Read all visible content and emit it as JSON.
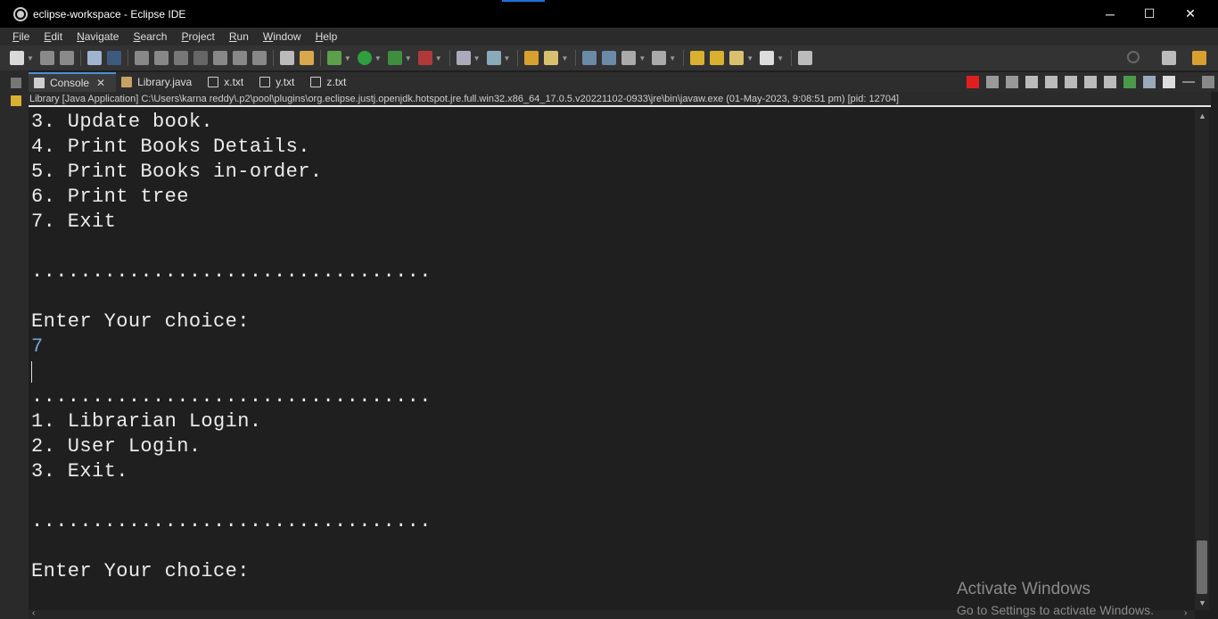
{
  "window": {
    "title": "eclipse-workspace - Eclipse IDE",
    "controls": {
      "minimize": "─",
      "maximize": "☐",
      "close": "✕"
    }
  },
  "menubar": [
    {
      "label": "File"
    },
    {
      "label": "Edit"
    },
    {
      "label": "Navigate"
    },
    {
      "label": "Search"
    },
    {
      "label": "Project"
    },
    {
      "label": "Run"
    },
    {
      "label": "Window"
    },
    {
      "label": "Help"
    }
  ],
  "tabs": [
    {
      "label": "Console",
      "icon": "console-icon",
      "active": true
    },
    {
      "label": "Library.java",
      "icon": "java-file-icon",
      "active": false
    },
    {
      "label": "x.txt",
      "icon": "text-file-icon",
      "active": false
    },
    {
      "label": "y.txt",
      "icon": "text-file-icon",
      "active": false
    },
    {
      "label": "z.txt",
      "icon": "text-file-icon",
      "active": false
    }
  ],
  "launch_label": "Library [Java Application] C:\\Users\\karna reddy\\.p2\\pool\\plugins\\org.eclipse.justj.openjdk.hotspot.jre.full.win32.x86_64_17.0.5.v20221102-0933\\jre\\bin\\javaw.exe  (01-May-2023, 9:08:51 pm) [pid: 12704]",
  "console": {
    "lines": [
      "3. Update book.",
      "4. Print Books Details.",
      "5. Print Books in-order.",
      "6. Print tree",
      "7. Exit",
      "",
      ".................................",
      "",
      "Enter Your choice:",
      "7",
      "",
      ".................................",
      "1. Librarian Login.",
      "2. User Login.",
      "3. Exit.",
      "",
      ".................................",
      "",
      "Enter Your choice:"
    ],
    "input_line_index": 9
  },
  "watermark": {
    "title": "Activate Windows",
    "subtitle": "Go to Settings to activate Windows."
  },
  "colors": {
    "accent": "#1e6fd9",
    "terminate": "#e02020",
    "user_input": "#7aa2d9"
  }
}
